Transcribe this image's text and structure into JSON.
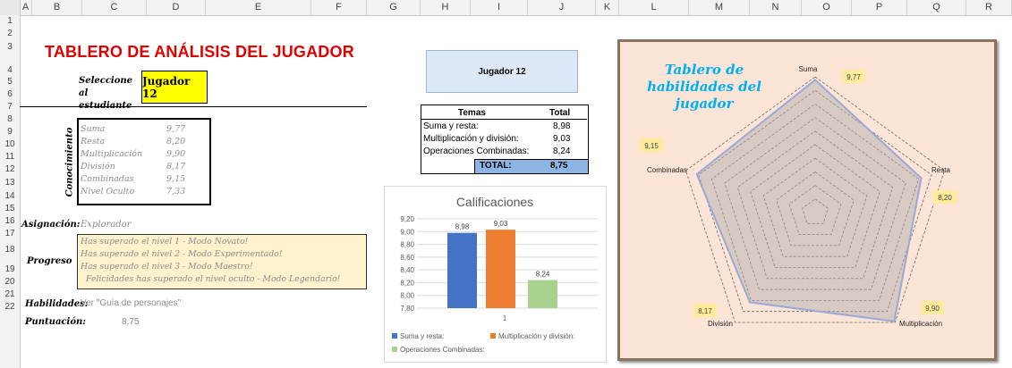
{
  "columns": [
    "A",
    "B",
    "C",
    "D",
    "E",
    "F",
    "G",
    "H",
    "I",
    "J",
    "K",
    "L",
    "M",
    "N",
    "O",
    "P",
    "Q",
    "R"
  ],
  "rows": [
    "1",
    "2",
    "3",
    "4",
    "5",
    "6",
    "7",
    "8",
    "9",
    "10",
    "11",
    "12",
    "13",
    "14",
    "15",
    "16",
    "17",
    "18",
    "19",
    "20",
    "21",
    "22"
  ],
  "dashboard": {
    "title": "TABLERO DE ANÁLISIS DEL JUGADOR",
    "select_label": "Seleccione al estudiante",
    "selected_player": "Jugador 12",
    "knowledge_label": "Conocimiento",
    "skills": [
      {
        "name": "Suma",
        "value": "9,77"
      },
      {
        "name": "Resta",
        "value": "8,20"
      },
      {
        "name": "Multiplicación",
        "value": "9,90"
      },
      {
        "name": "División",
        "value": "8,17"
      },
      {
        "name": "Combinadas",
        "value": "9,15"
      },
      {
        "name": "Nivel Oculto",
        "value": "7,33"
      }
    ],
    "assignment_label": "Asignación:",
    "assignment_value": "Explorador",
    "progress_label": "Progreso",
    "progress_lines": [
      "Has superado el nivel 1 - Modo Novato!",
      "Has superado el nivel 2 - Modo Experimentado!",
      "Has superado el nivel 3 - Modo Maestro!",
      "Felicidades has superado el nivel oculto - Modo Legendario!"
    ],
    "skills_label": "Habilidades:",
    "skills_value": "Ver \"Guía de personajes\"",
    "score_label": "Puntuación:",
    "score_value": "8,75"
  },
  "summary": {
    "player_box": "Jugador 12",
    "headers": [
      "Temas",
      "Total"
    ],
    "rows": [
      {
        "topic": "Suma y resta:",
        "total": "8,98"
      },
      {
        "topic": "Multiplicación y división:",
        "total": "9,03"
      },
      {
        "topic": "Operaciones Combinadas:",
        "total": "8,24"
      }
    ],
    "total_label": "TOTAL:",
    "total_value": "8,75"
  },
  "radar_title": "Tablero de habilidades del jugador",
  "colors": {
    "title_red": "#e00000",
    "player_yellow": "#ffff00",
    "bar_blue": "#4472c4",
    "bar_orange": "#ed7d31",
    "bar_green": "#a9d18e",
    "radar_bg": "#fce4d6",
    "radar_title": "#00b0f0"
  },
  "chart_data": [
    {
      "type": "bar",
      "title": "Calificaciones",
      "categories": [
        "1"
      ],
      "series": [
        {
          "name": "Suma y resta:",
          "values": [
            8.98
          ],
          "color": "#4472c4"
        },
        {
          "name": "Multiplicación y división:",
          "values": [
            9.03
          ],
          "color": "#ed7d31"
        },
        {
          "name": "Operaciones Combinadas:",
          "values": [
            8.24
          ],
          "color": "#a9d18e"
        }
      ],
      "ylim": [
        7.8,
        9.2
      ],
      "yticks": [
        "7,80",
        "8,00",
        "8,20",
        "8,40",
        "8,60",
        "8,80",
        "9,00",
        "9,20"
      ],
      "data_labels": [
        "8,98",
        "9,03",
        "8,24"
      ],
      "legend": "bottom",
      "grid": true
    },
    {
      "type": "radar",
      "title": "Tablero de habilidades del jugador",
      "categories": [
        "Suma",
        "Resta",
        "Multiplicación",
        "División",
        "Combinadas"
      ],
      "values": [
        9.77,
        8.2,
        9.9,
        8.17,
        9.15
      ],
      "data_labels": [
        "9,77",
        "8,20",
        "9,90",
        "8,17",
        "9,15"
      ],
      "rmax": 10,
      "rings": 10
    }
  ]
}
